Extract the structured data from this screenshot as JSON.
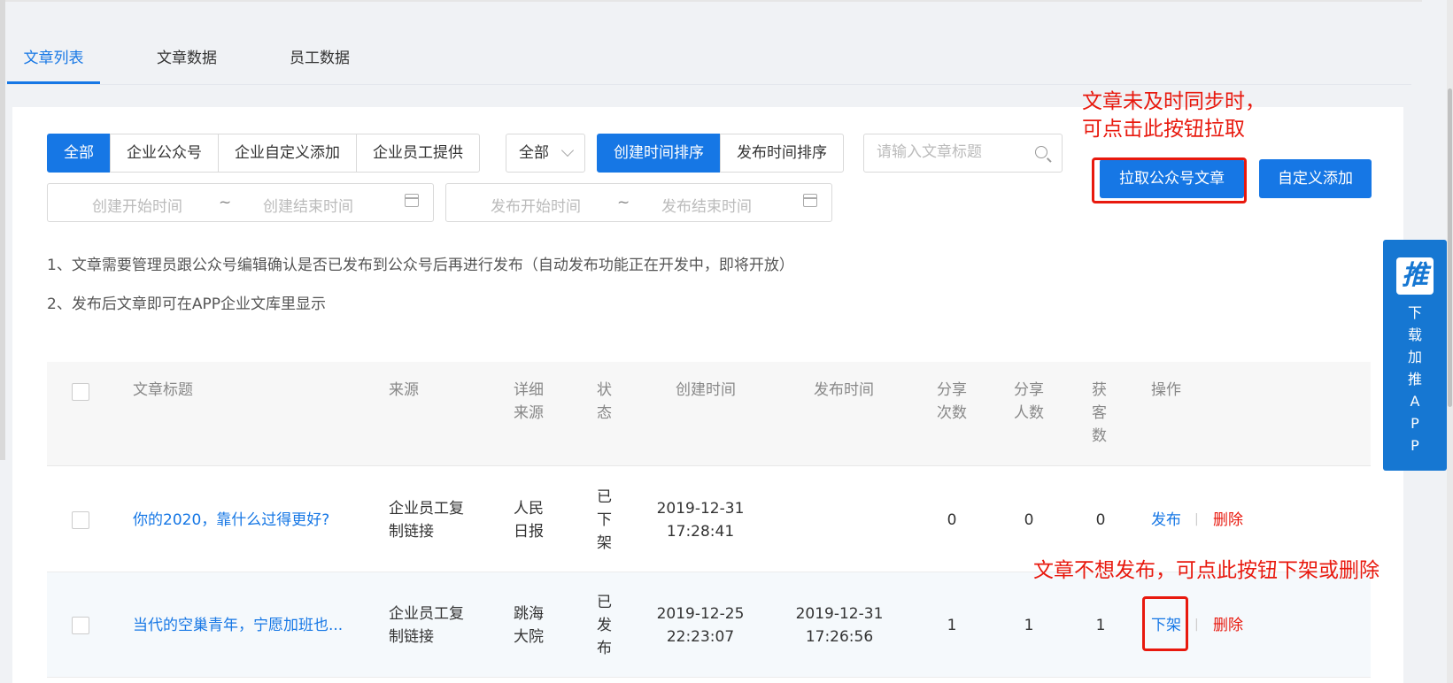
{
  "tabs": [
    {
      "label": "文章列表",
      "active": true
    },
    {
      "label": "文章数据",
      "active": false
    },
    {
      "label": "员工数据",
      "active": false
    }
  ],
  "filters": {
    "source_group": [
      "全部",
      "企业公众号",
      "企业自定义添加",
      "企业员工提供"
    ],
    "source_group_active": "全部",
    "status_select": "全部",
    "sort_group": [
      "创建时间排序",
      "发布时间排序"
    ],
    "sort_active": "创建时间排序",
    "search_placeholder": "请输入文章标题",
    "create_range": {
      "start": "创建开始时间",
      "sep": "~",
      "end": "创建结束时间"
    },
    "publish_range": {
      "start": "发布开始时间",
      "sep": "~",
      "end": "发布结束时间"
    }
  },
  "actions": {
    "pull": "拉取公众号文章",
    "custom_add": "自定义添加"
  },
  "annotations": {
    "pull_hint_line1": "文章未及时同步时，",
    "pull_hint_line2": "可点击此按钮拉取",
    "unpublish_hint": "文章不想发布，可点此按钮下架或删除"
  },
  "notes": [
    "1、文章需要管理员跟公众号编辑确认是否已发布到公众号后再进行发布（自动发布功能正在开发中，即将开放）",
    "2、发布后文章即可在APP企业文库里显示"
  ],
  "table": {
    "headers": {
      "title": "文章标题",
      "source": "来源",
      "detail_source": [
        "详细",
        "来源"
      ],
      "status": [
        "状",
        "态"
      ],
      "created": "创建时间",
      "published": "发布时间",
      "share_count": [
        "分享",
        "次数"
      ],
      "share_users": [
        "分享",
        "人数"
      ],
      "customers": [
        "获",
        "客",
        "数"
      ],
      "ops": "操作"
    },
    "rows": [
      {
        "title": "你的2020，靠什么过得更好?",
        "source": [
          "企业员工复",
          "制链接"
        ],
        "detail_source": [
          "人民",
          "日报"
        ],
        "status": [
          "已",
          "下",
          "架"
        ],
        "created": [
          "2019-12-31",
          "17:28:41"
        ],
        "published": [
          "",
          ""
        ],
        "share_count": "0",
        "share_users": "0",
        "customers": "0",
        "op_primary": "发布",
        "op_sep": "|",
        "op_delete": "删除"
      },
      {
        "title": "当代的空巢青年，宁愿加班也...",
        "source": [
          "企业员工复",
          "制链接"
        ],
        "detail_source": [
          "跳海",
          "大院"
        ],
        "status": [
          "已",
          "发",
          "布"
        ],
        "created": [
          "2019-12-25",
          "22:23:07"
        ],
        "published": [
          "2019-12-31",
          "17:26:56"
        ],
        "share_count": "1",
        "share_users": "1",
        "customers": "1",
        "op_primary": "下架",
        "op_sep": "|",
        "op_delete": "删除"
      }
    ]
  },
  "side_app": {
    "logo": "推",
    "text": [
      "下",
      "载",
      "加",
      "推",
      "A",
      "P",
      "P"
    ]
  },
  "colors": {
    "primary": "#1677e5",
    "annotation_red": "#e8190e",
    "delete_red": "#e8190e"
  }
}
